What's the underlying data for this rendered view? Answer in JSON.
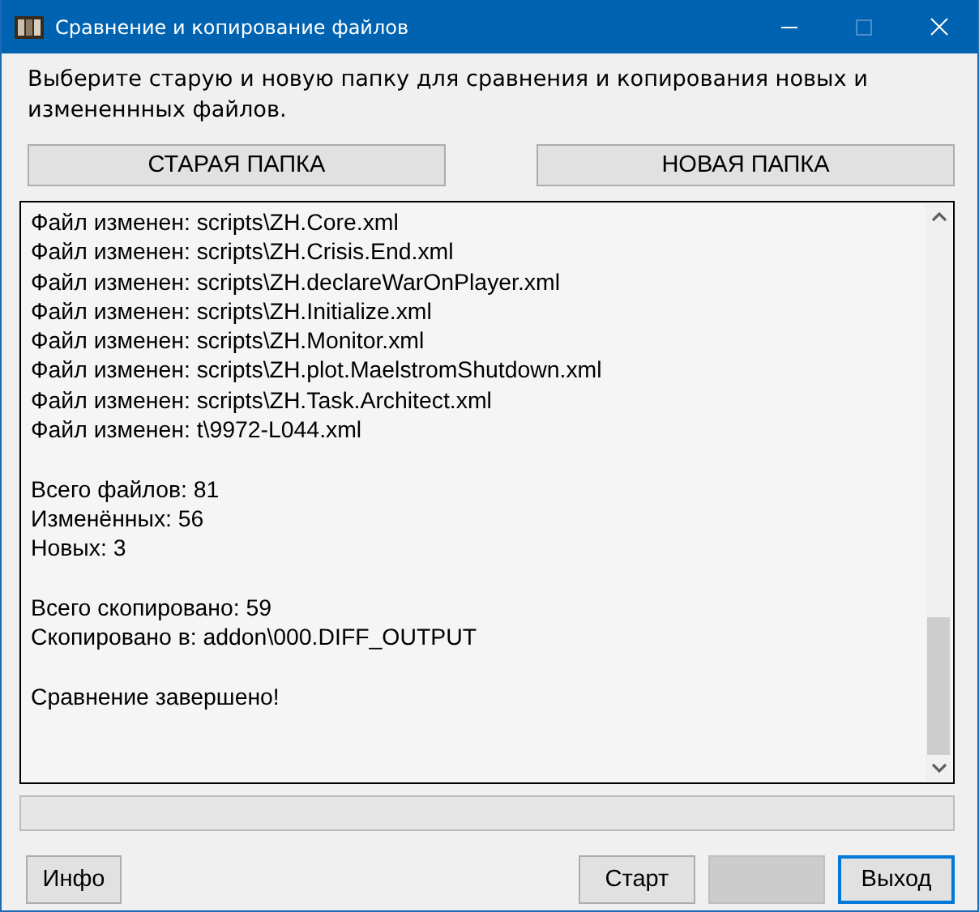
{
  "window": {
    "title": "Сравнение и копирование файлов"
  },
  "instruction": "Выберите старую и новую папку для сравнения и копирования новых и измененнных файлов.",
  "folder_buttons": [
    "СТАРАЯ ПАПКА",
    "НОВАЯ ПАПКА"
  ],
  "log": {
    "blocks": [
      [
        "Файл изменен: scripts\\ZH.Core.xml",
        "Файл изменен: scripts\\ZH.Crisis.End.xml",
        "Файл изменен: scripts\\ZH.declareWarOnPlayer.xml",
        "Файл изменен: scripts\\ZH.Initialize.xml",
        "Файл изменен: scripts\\ZH.Monitor.xml",
        "Файл изменен: scripts\\ZH.plot.MaelstromShutdown.xml",
        "Файл изменен: scripts\\ZH.Task.Architect.xml",
        "Файл изменен: t\\9972-L044.xml"
      ],
      [
        "Всего файлов: 81",
        "Изменённых: 56",
        "Новых: 3"
      ],
      [
        "Всего скопировано: 59",
        "Скопировано в: addon\\000.DIFF_OUTPUT"
      ],
      [
        "Сравнение завершено!"
      ]
    ]
  },
  "progress": {
    "level": 0
  },
  "buttons": [
    {
      "label": "Инфо",
      "disabled": false,
      "focused": false
    },
    {
      "label": "Старт",
      "disabled": false,
      "focused": false
    },
    {
      "disabled": true,
      "focused": false
    },
    {
      "label": "Выход",
      "disabled": false,
      "focused": true
    }
  ]
}
